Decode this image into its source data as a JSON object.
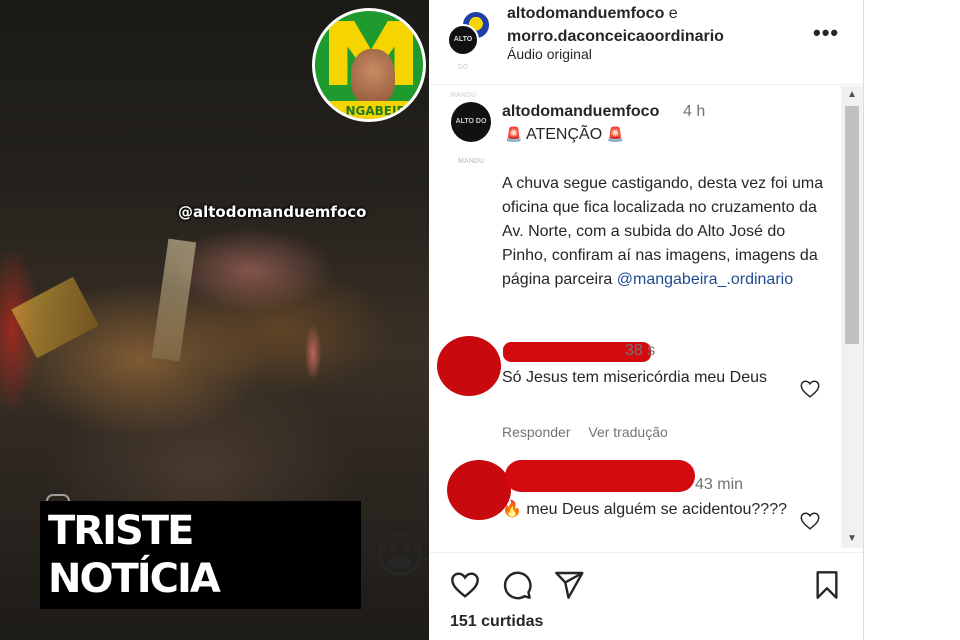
{
  "video": {
    "watermark": "@altodomanduemfoco",
    "logo_band_text": "NGABEIRA",
    "caption": "TRISTE NOTÍCIA",
    "caption_emoji": "😭"
  },
  "post": {
    "header": {
      "user1": "altodomanduemfoco",
      "conjunction": "e",
      "user2": "morro.daconceicaoordinario",
      "audio": "Áudio original",
      "avatar_text": "ALTO DO MANDU",
      "more_icon": "more-horizontal-icon"
    },
    "caption": {
      "username": "altodomanduemfoco",
      "time": "4 h",
      "title": "ATENÇÃO",
      "siren_icon": "🚨",
      "body": "A chuva segue castigando, desta vez foi uma oficina que fica localizada no cruzamento da Av. Norte, com a subida do Alto José do Pinho, confiram aí nas imagens, imagens da página parceira",
      "mention": "@mangabeira_.ordinario"
    },
    "comments": [
      {
        "time": "38 s",
        "text": "Só Jesus tem misericórdia meu Deus",
        "reply": "Responder",
        "translate": "Ver tradução"
      },
      {
        "time": "43 min",
        "emoji": "🔥",
        "text": "meu Deus alguém se acidentou????"
      }
    ],
    "likes": "151 curtidas"
  },
  "colors": {
    "redaction": "#d30b0e",
    "mention_link": "#1e4c8f",
    "muted_text": "#737373"
  }
}
